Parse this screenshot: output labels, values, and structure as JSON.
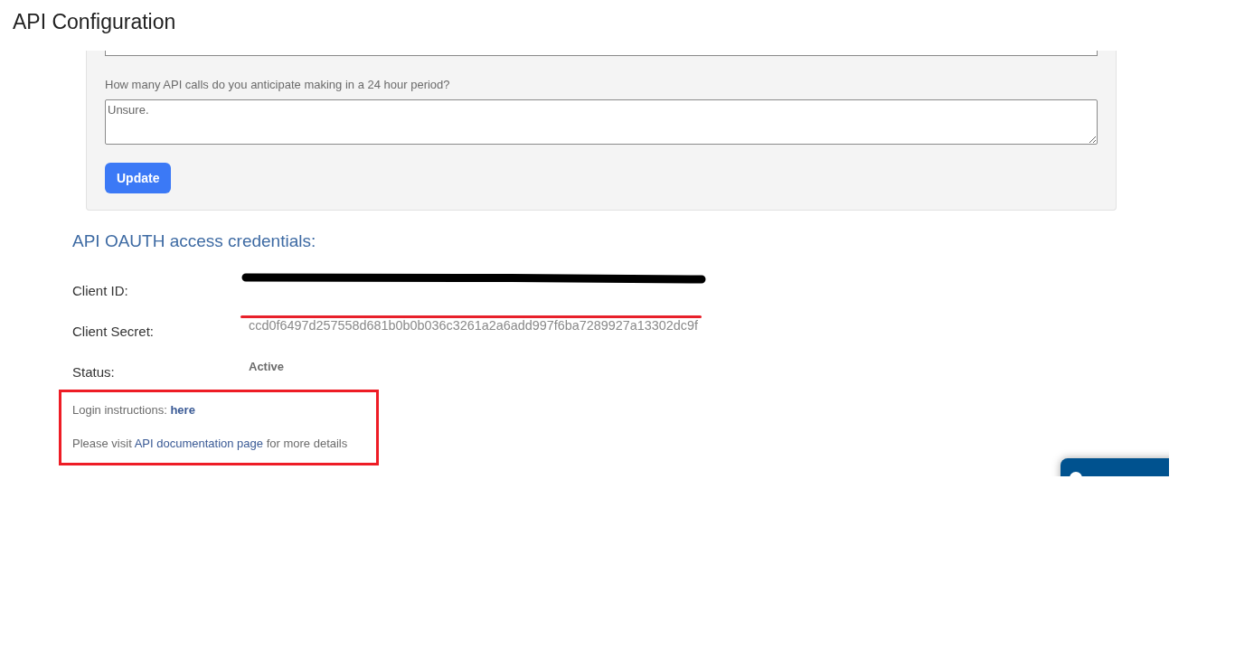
{
  "header": {
    "title": "API Configuration"
  },
  "form": {
    "question": "How many API calls do you anticipate making in a 24 hour period?",
    "answer": "Unsure.",
    "submit": "Update"
  },
  "credentials": {
    "heading": "API OAUTH access credentials:",
    "rows": [
      {
        "label": "Client ID:",
        "kind": "redacted"
      },
      {
        "label": "Client Secret:",
        "kind": "struck",
        "value": "ccd0f6497d257558d681b0b0b036c3261a2a6add997f6ba7289927a13302dc9f"
      },
      {
        "label": "Status:",
        "kind": "status",
        "value": "Active"
      }
    ]
  },
  "help": {
    "login": {
      "text": "Login instructions:",
      "link": "here"
    },
    "docs": {
      "before": "Please visit",
      "link": "API documentation page",
      "after": "for more details"
    }
  }
}
